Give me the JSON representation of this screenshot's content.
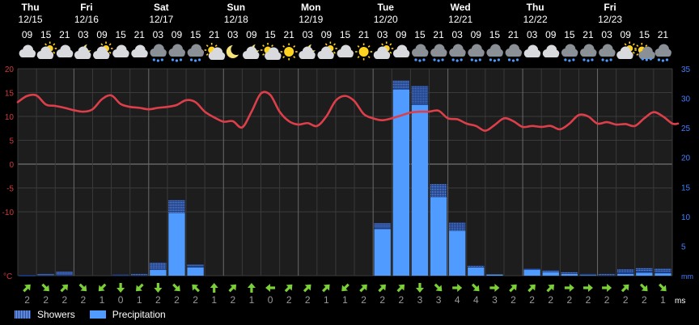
{
  "chart_data": {
    "type": "line+bar",
    "title": "",
    "days": [
      {
        "weekday": "Thu",
        "date": "12/15",
        "from": 0
      },
      {
        "weekday": "Fri",
        "date": "12/16",
        "from": 3
      },
      {
        "weekday": "Sat",
        "date": "12/17",
        "from": 7
      },
      {
        "weekday": "Sun",
        "date": "12/18",
        "from": 11
      },
      {
        "weekday": "Mon",
        "date": "12/19",
        "from": 15
      },
      {
        "weekday": "Tue",
        "date": "12/20",
        "from": 19
      },
      {
        "weekday": "Wed",
        "date": "12/21",
        "from": 23
      },
      {
        "weekday": "Thu",
        "date": "12/22",
        "from": 27
      },
      {
        "weekday": "Fri",
        "date": "12/23",
        "from": 31
      }
    ],
    "hours": [
      "09",
      "15",
      "21",
      "03",
      "09",
      "15",
      "21",
      "03",
      "09",
      "15",
      "21",
      "03",
      "09",
      "15",
      "21",
      "03",
      "09",
      "15",
      "21",
      "03",
      "09",
      "15",
      "21",
      "03",
      "09",
      "15",
      "21",
      "03",
      "09",
      "15",
      "21",
      "03",
      "09",
      "15",
      "21"
    ],
    "icons": [
      "cloudy",
      "partly-cloudy",
      "cloudy",
      "night-partly-cloudy",
      "partly-cloudy",
      "cloudy",
      "cloudy",
      "cloudy-rain",
      "cloudy-rain",
      "cloudy-rain",
      "partly-sunny",
      "night-clear",
      "night-partly-cloudy",
      "partly-sunny",
      "sunny",
      "night-partly-cloudy",
      "partly-cloudy",
      "cloudy",
      "sunny",
      "partly-cloudy",
      "cloudy",
      "cloudy-rain",
      "cloudy-rain",
      "cloudy-rain",
      "cloudy-rain",
      "cloudy-rain",
      "cloudy-rain",
      "cloudy",
      "cloudy",
      "cloudy-rain",
      "cloudy-rain",
      "cloudy-rain",
      "partly-cloudy",
      "partly-sunny-rain",
      "cloudy-rain"
    ],
    "temperature": {
      "unit": "°C",
      "axis_ticks": [
        20,
        15,
        10,
        5,
        0,
        -5,
        -10
      ],
      "points": [
        [
          0,
          13
        ],
        [
          0.5,
          14.3
        ],
        [
          1,
          14.4
        ],
        [
          1.5,
          12.5
        ],
        [
          2,
          12.2
        ],
        [
          2.5,
          11.8
        ],
        [
          3,
          11.3
        ],
        [
          3.5,
          11
        ],
        [
          4,
          11.5
        ],
        [
          4.5,
          13.6
        ],
        [
          5,
          14.4
        ],
        [
          5.5,
          12.6
        ],
        [
          6,
          12
        ],
        [
          6.5,
          11.8
        ],
        [
          7,
          11.5
        ],
        [
          7.5,
          11.8
        ],
        [
          8,
          12
        ],
        [
          8.5,
          12.4
        ],
        [
          9,
          13.4
        ],
        [
          9.5,
          13
        ],
        [
          10,
          11
        ],
        [
          10.5,
          9.8
        ],
        [
          11,
          8.9
        ],
        [
          11.5,
          9
        ],
        [
          12,
          7.7
        ],
        [
          12.5,
          11
        ],
        [
          13,
          14.8
        ],
        [
          13.5,
          14.5
        ],
        [
          14,
          11
        ],
        [
          14.5,
          9
        ],
        [
          15,
          8.3
        ],
        [
          15.5,
          8.6
        ],
        [
          16,
          8
        ],
        [
          16.5,
          10
        ],
        [
          17,
          13.3
        ],
        [
          17.5,
          14.3
        ],
        [
          18,
          13.2
        ],
        [
          18.5,
          10.5
        ],
        [
          19,
          9.6
        ],
        [
          19.5,
          9.2
        ],
        [
          20,
          9.6
        ],
        [
          20.5,
          10.2
        ],
        [
          21,
          10.8
        ],
        [
          21.5,
          11
        ],
        [
          22,
          11
        ],
        [
          22.5,
          11.2
        ],
        [
          23,
          9.6
        ],
        [
          23.5,
          9.4
        ],
        [
          24,
          8.5
        ],
        [
          24.5,
          8
        ],
        [
          25,
          7
        ],
        [
          25.5,
          8.2
        ],
        [
          26,
          9.6
        ],
        [
          26.5,
          9
        ],
        [
          27,
          7.8
        ],
        [
          27.5,
          8
        ],
        [
          28,
          7.8
        ],
        [
          28.5,
          8
        ],
        [
          29,
          7.3
        ],
        [
          29.5,
          8.5
        ],
        [
          30,
          10.3
        ],
        [
          30.5,
          10
        ],
        [
          31,
          8.5
        ],
        [
          31.5,
          8.8
        ],
        [
          32,
          8.3
        ],
        [
          32.5,
          8.4
        ],
        [
          33,
          8
        ],
        [
          33.5,
          9.6
        ],
        [
          34,
          10.9
        ],
        [
          34.5,
          10
        ],
        [
          35,
          8.5
        ],
        [
          35.3,
          8.5
        ]
      ]
    },
    "precipitation": {
      "unit": "mm",
      "axis_ticks": [
        35,
        30,
        25,
        20,
        15,
        10,
        5
      ],
      "bars": [
        {
          "i": 0,
          "precip": 0,
          "showers": 0.1
        },
        {
          "i": 1,
          "precip": 0,
          "showers": 0.3
        },
        {
          "i": 2,
          "precip": 0,
          "showers": 0.7
        },
        {
          "i": 3,
          "precip": 0,
          "showers": 0
        },
        {
          "i": 4,
          "precip": 0,
          "showers": 0
        },
        {
          "i": 5,
          "precip": 0,
          "showers": 0.2
        },
        {
          "i": 6,
          "precip": 0,
          "showers": 0.3
        },
        {
          "i": 7,
          "precip": 1,
          "showers": 1.2
        },
        {
          "i": 8,
          "precip": 10.6,
          "showers": 2.2
        },
        {
          "i": 9,
          "precip": 1.4,
          "showers": 0.5
        },
        {
          "i": 19,
          "precip": 7.9,
          "showers": 1
        },
        {
          "i": 20,
          "precip": 31.5,
          "showers": 1.5
        },
        {
          "i": 21,
          "precip": 28.9,
          "showers": 3.2
        },
        {
          "i": 22,
          "precip": 13.3,
          "showers": 2.2
        },
        {
          "i": 23,
          "precip": 7.6,
          "showers": 1.4
        },
        {
          "i": 24,
          "precip": 1.4,
          "showers": 0.3
        },
        {
          "i": 25,
          "precip": 0.2,
          "showers": 0
        },
        {
          "i": 27,
          "precip": 1.1,
          "showers": 0.1
        },
        {
          "i": 28,
          "precip": 0.6,
          "showers": 0.3
        },
        {
          "i": 29,
          "precip": 0.3,
          "showers": 0.3
        },
        {
          "i": 30,
          "precip": 0.1,
          "showers": 0.2
        },
        {
          "i": 31,
          "precip": 0,
          "showers": 0.3
        },
        {
          "i": 32,
          "precip": 0.3,
          "showers": 0.8
        },
        {
          "i": 33,
          "precip": 0.5,
          "showers": 0.8
        },
        {
          "i": 34,
          "precip": 0.4,
          "showers": 0.8
        }
      ]
    },
    "wind": {
      "unit": "ms",
      "directions": [
        "NE",
        "SE",
        "NE",
        "SE",
        "SW",
        "S",
        "SW",
        "S",
        "SE",
        "NW",
        "N",
        "NE",
        "N",
        "W",
        "NE",
        "NE",
        "NE",
        "SW",
        "NE",
        "NE",
        "NE",
        "S",
        "SE",
        "E",
        "SE",
        "E",
        "NE",
        "NE",
        "NE",
        "E",
        "E",
        "E",
        "NE",
        "SE",
        "SE"
      ],
      "speeds": [
        2,
        2,
        2,
        2,
        1,
        0,
        1,
        2,
        2,
        2,
        1,
        2,
        1,
        0,
        2,
        2,
        1,
        1,
        2,
        2,
        2,
        3,
        3,
        4,
        4,
        3,
        2,
        2,
        2,
        2,
        2,
        2,
        2,
        2,
        1
      ]
    },
    "legend": [
      {
        "name": "Showers"
      },
      {
        "name": "Precipitation"
      }
    ],
    "colors": {
      "temperature": "#dd3f4a",
      "precipitation": "#4f9bff",
      "showers_dark": "#1c3f8a",
      "showers_light": "#9bbcff",
      "grid": "#3a3a3a",
      "day_line": "#6a6a6a",
      "zero_line": "#888888",
      "left_axis": "#d23a3a",
      "right_axis": "#3f7fff",
      "arrow": "#7bd03a"
    }
  }
}
